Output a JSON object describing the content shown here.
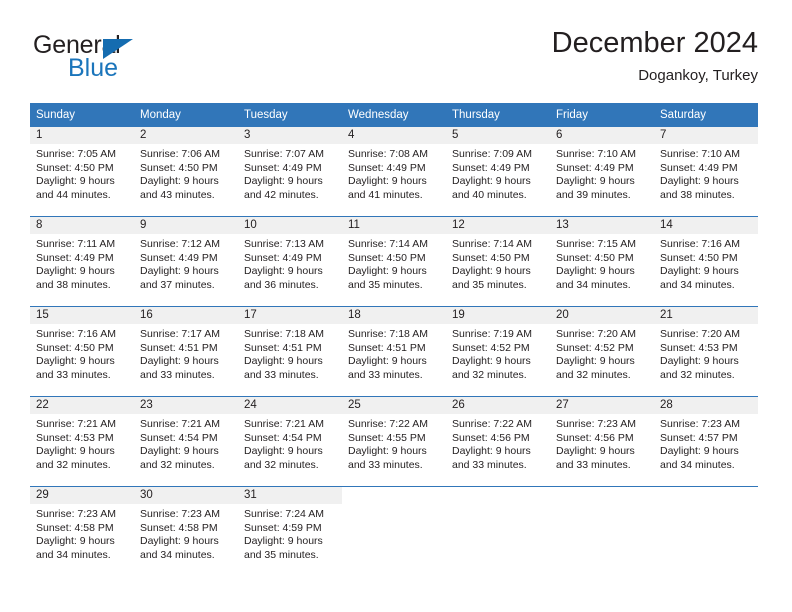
{
  "brand": {
    "name_part1": "General",
    "name_part2": "Blue",
    "triangle_color": "#156cb0",
    "blue_color": "#1b75bb"
  },
  "header": {
    "title": "December 2024",
    "subtitle": "Dogankoy, Turkey"
  },
  "colors": {
    "header_band": "#3176b9",
    "daynum_band": "#f0f0f0",
    "text": "#231f20"
  },
  "weekday_headers": [
    "Sunday",
    "Monday",
    "Tuesday",
    "Wednesday",
    "Thursday",
    "Friday",
    "Saturday"
  ],
  "weeks": [
    [
      {
        "day": "1",
        "sunrise": "Sunrise: 7:05 AM",
        "sunset": "Sunset: 4:50 PM",
        "daylight1": "Daylight: 9 hours",
        "daylight2": "and 44 minutes."
      },
      {
        "day": "2",
        "sunrise": "Sunrise: 7:06 AM",
        "sunset": "Sunset: 4:50 PM",
        "daylight1": "Daylight: 9 hours",
        "daylight2": "and 43 minutes."
      },
      {
        "day": "3",
        "sunrise": "Sunrise: 7:07 AM",
        "sunset": "Sunset: 4:49 PM",
        "daylight1": "Daylight: 9 hours",
        "daylight2": "and 42 minutes."
      },
      {
        "day": "4",
        "sunrise": "Sunrise: 7:08 AM",
        "sunset": "Sunset: 4:49 PM",
        "daylight1": "Daylight: 9 hours",
        "daylight2": "and 41 minutes."
      },
      {
        "day": "5",
        "sunrise": "Sunrise: 7:09 AM",
        "sunset": "Sunset: 4:49 PM",
        "daylight1": "Daylight: 9 hours",
        "daylight2": "and 40 minutes."
      },
      {
        "day": "6",
        "sunrise": "Sunrise: 7:10 AM",
        "sunset": "Sunset: 4:49 PM",
        "daylight1": "Daylight: 9 hours",
        "daylight2": "and 39 minutes."
      },
      {
        "day": "7",
        "sunrise": "Sunrise: 7:10 AM",
        "sunset": "Sunset: 4:49 PM",
        "daylight1": "Daylight: 9 hours",
        "daylight2": "and 38 minutes."
      }
    ],
    [
      {
        "day": "8",
        "sunrise": "Sunrise: 7:11 AM",
        "sunset": "Sunset: 4:49 PM",
        "daylight1": "Daylight: 9 hours",
        "daylight2": "and 38 minutes."
      },
      {
        "day": "9",
        "sunrise": "Sunrise: 7:12 AM",
        "sunset": "Sunset: 4:49 PM",
        "daylight1": "Daylight: 9 hours",
        "daylight2": "and 37 minutes."
      },
      {
        "day": "10",
        "sunrise": "Sunrise: 7:13 AM",
        "sunset": "Sunset: 4:49 PM",
        "daylight1": "Daylight: 9 hours",
        "daylight2": "and 36 minutes."
      },
      {
        "day": "11",
        "sunrise": "Sunrise: 7:14 AM",
        "sunset": "Sunset: 4:50 PM",
        "daylight1": "Daylight: 9 hours",
        "daylight2": "and 35 minutes."
      },
      {
        "day": "12",
        "sunrise": "Sunrise: 7:14 AM",
        "sunset": "Sunset: 4:50 PM",
        "daylight1": "Daylight: 9 hours",
        "daylight2": "and 35 minutes."
      },
      {
        "day": "13",
        "sunrise": "Sunrise: 7:15 AM",
        "sunset": "Sunset: 4:50 PM",
        "daylight1": "Daylight: 9 hours",
        "daylight2": "and 34 minutes."
      },
      {
        "day": "14",
        "sunrise": "Sunrise: 7:16 AM",
        "sunset": "Sunset: 4:50 PM",
        "daylight1": "Daylight: 9 hours",
        "daylight2": "and 34 minutes."
      }
    ],
    [
      {
        "day": "15",
        "sunrise": "Sunrise: 7:16 AM",
        "sunset": "Sunset: 4:50 PM",
        "daylight1": "Daylight: 9 hours",
        "daylight2": "and 33 minutes."
      },
      {
        "day": "16",
        "sunrise": "Sunrise: 7:17 AM",
        "sunset": "Sunset: 4:51 PM",
        "daylight1": "Daylight: 9 hours",
        "daylight2": "and 33 minutes."
      },
      {
        "day": "17",
        "sunrise": "Sunrise: 7:18 AM",
        "sunset": "Sunset: 4:51 PM",
        "daylight1": "Daylight: 9 hours",
        "daylight2": "and 33 minutes."
      },
      {
        "day": "18",
        "sunrise": "Sunrise: 7:18 AM",
        "sunset": "Sunset: 4:51 PM",
        "daylight1": "Daylight: 9 hours",
        "daylight2": "and 33 minutes."
      },
      {
        "day": "19",
        "sunrise": "Sunrise: 7:19 AM",
        "sunset": "Sunset: 4:52 PM",
        "daylight1": "Daylight: 9 hours",
        "daylight2": "and 32 minutes."
      },
      {
        "day": "20",
        "sunrise": "Sunrise: 7:20 AM",
        "sunset": "Sunset: 4:52 PM",
        "daylight1": "Daylight: 9 hours",
        "daylight2": "and 32 minutes."
      },
      {
        "day": "21",
        "sunrise": "Sunrise: 7:20 AM",
        "sunset": "Sunset: 4:53 PM",
        "daylight1": "Daylight: 9 hours",
        "daylight2": "and 32 minutes."
      }
    ],
    [
      {
        "day": "22",
        "sunrise": "Sunrise: 7:21 AM",
        "sunset": "Sunset: 4:53 PM",
        "daylight1": "Daylight: 9 hours",
        "daylight2": "and 32 minutes."
      },
      {
        "day": "23",
        "sunrise": "Sunrise: 7:21 AM",
        "sunset": "Sunset: 4:54 PM",
        "daylight1": "Daylight: 9 hours",
        "daylight2": "and 32 minutes."
      },
      {
        "day": "24",
        "sunrise": "Sunrise: 7:21 AM",
        "sunset": "Sunset: 4:54 PM",
        "daylight1": "Daylight: 9 hours",
        "daylight2": "and 32 minutes."
      },
      {
        "day": "25",
        "sunrise": "Sunrise: 7:22 AM",
        "sunset": "Sunset: 4:55 PM",
        "daylight1": "Daylight: 9 hours",
        "daylight2": "and 33 minutes."
      },
      {
        "day": "26",
        "sunrise": "Sunrise: 7:22 AM",
        "sunset": "Sunset: 4:56 PM",
        "daylight1": "Daylight: 9 hours",
        "daylight2": "and 33 minutes."
      },
      {
        "day": "27",
        "sunrise": "Sunrise: 7:23 AM",
        "sunset": "Sunset: 4:56 PM",
        "daylight1": "Daylight: 9 hours",
        "daylight2": "and 33 minutes."
      },
      {
        "day": "28",
        "sunrise": "Sunrise: 7:23 AM",
        "sunset": "Sunset: 4:57 PM",
        "daylight1": "Daylight: 9 hours",
        "daylight2": "and 34 minutes."
      }
    ],
    [
      {
        "day": "29",
        "sunrise": "Sunrise: 7:23 AM",
        "sunset": "Sunset: 4:58 PM",
        "daylight1": "Daylight: 9 hours",
        "daylight2": "and 34 minutes."
      },
      {
        "day": "30",
        "sunrise": "Sunrise: 7:23 AM",
        "sunset": "Sunset: 4:58 PM",
        "daylight1": "Daylight: 9 hours",
        "daylight2": "and 34 minutes."
      },
      {
        "day": "31",
        "sunrise": "Sunrise: 7:24 AM",
        "sunset": "Sunset: 4:59 PM",
        "daylight1": "Daylight: 9 hours",
        "daylight2": "and 35 minutes."
      },
      {
        "day": "",
        "sunrise": "",
        "sunset": "",
        "daylight1": "",
        "daylight2": ""
      },
      {
        "day": "",
        "sunrise": "",
        "sunset": "",
        "daylight1": "",
        "daylight2": ""
      },
      {
        "day": "",
        "sunrise": "",
        "sunset": "",
        "daylight1": "",
        "daylight2": ""
      },
      {
        "day": "",
        "sunrise": "",
        "sunset": "",
        "daylight1": "",
        "daylight2": ""
      }
    ]
  ]
}
